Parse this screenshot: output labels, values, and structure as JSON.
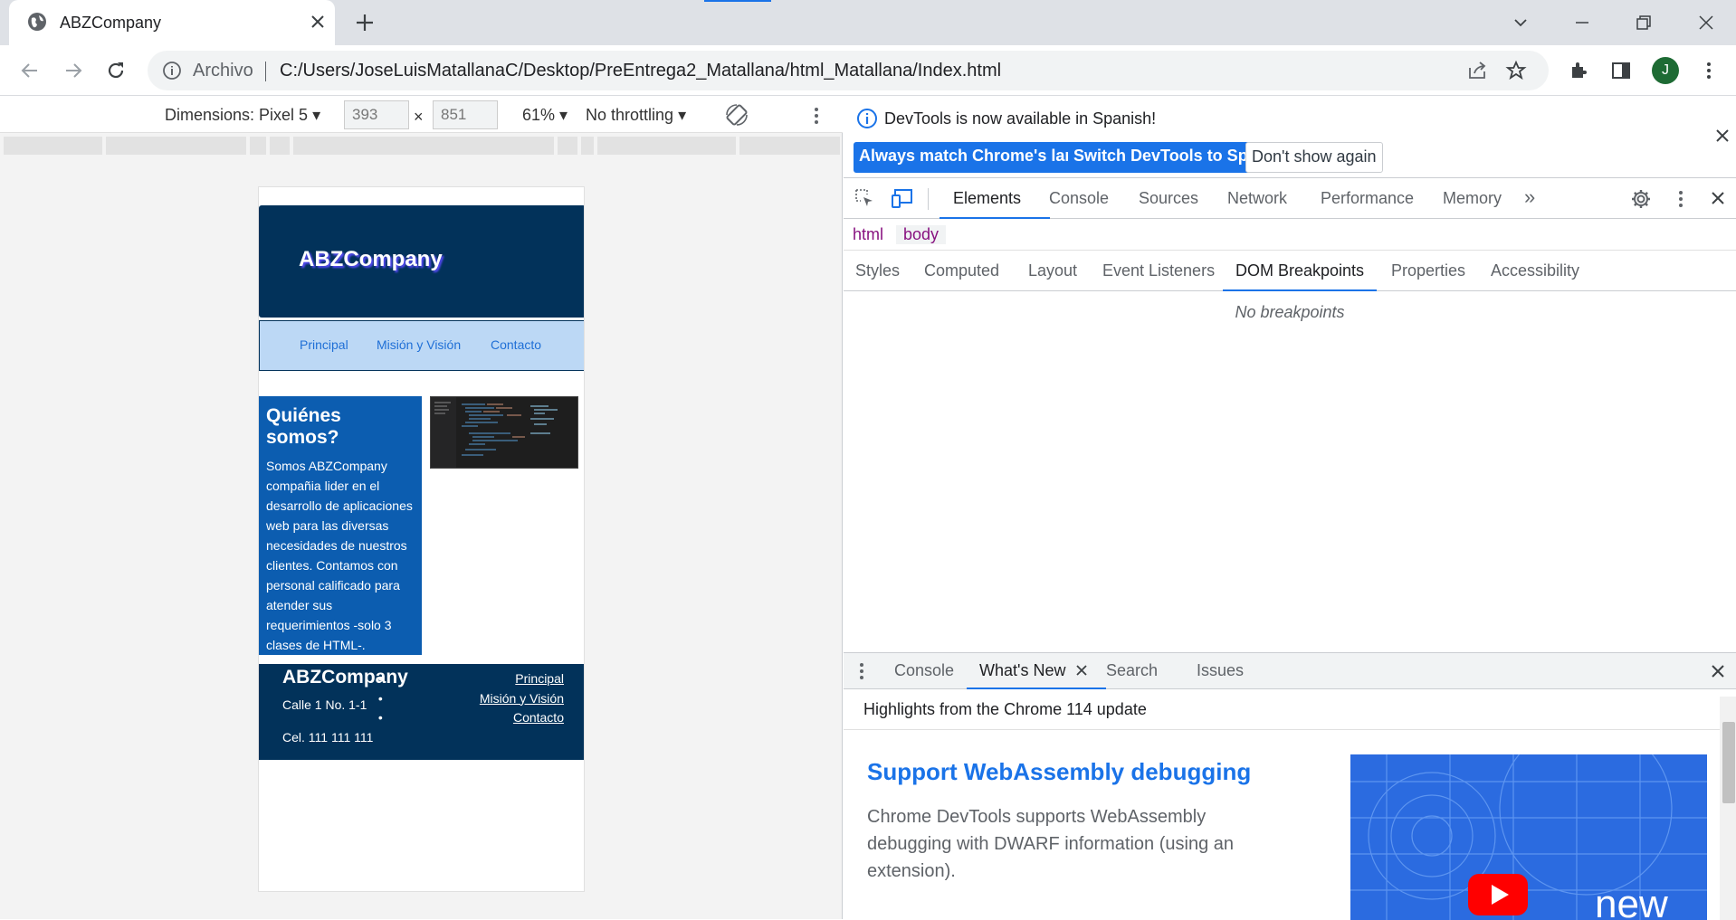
{
  "browser": {
    "tab_title": "ABZCompany",
    "scheme_label": "Archivo",
    "url": "C:/Users/JoseLuisMatallanaC/Desktop/PreEntrega2_Matallana/html_Matallana/Index.html",
    "profile_initial": "J"
  },
  "device_toolbar": {
    "dimensions_label": "Dimensions: Pixel 5",
    "width": "393",
    "height": "851",
    "times": "×",
    "zoom": "61%",
    "throttling": "No throttling"
  },
  "site": {
    "brand": "ABZCompany",
    "nav": [
      "Principal",
      "Misión y Visión",
      "Contacto"
    ],
    "about_title": "Quiénes somos?",
    "about_text": "Somos ABZCompany compañia lider en el desarrollo de aplicaciones web para las diversas necesidades de nuestros clientes. Contamos con personal calificado para atender sus requerimientos -solo 3 clases de HTML-.",
    "footer_brand": "ABZCompany",
    "footer_address": "Calle 1 No. 1-1",
    "footer_phone": "Cel. 111 111 111",
    "footer_links": [
      "Principal",
      "Misión y Visión",
      "Contacto"
    ]
  },
  "devtools": {
    "info_message": "DevTools is now available in Spanish!",
    "btn_match": "Always match Chrome's language",
    "btn_switch": "Switch DevTools to Spanish",
    "btn_dismiss": "Don't show again",
    "main_tabs": [
      "Elements",
      "Console",
      "Sources",
      "Network",
      "Performance",
      "Memory"
    ],
    "active_main_tab": "Elements",
    "breadcrumbs": [
      "html",
      "body"
    ],
    "sub_tabs": [
      "Styles",
      "Computed",
      "Layout",
      "Event Listeners",
      "DOM Breakpoints",
      "Properties",
      "Accessibility"
    ],
    "active_sub_tab": "DOM Breakpoints",
    "empty_message": "No breakpoints",
    "drawer_tabs": [
      "Console",
      "What's New",
      "Search",
      "Issues"
    ],
    "active_drawer_tab": "What's New",
    "highlights": "Highlights from the Chrome 114 update",
    "whatsnew_title": "Support WebAssembly debugging",
    "whatsnew_desc": "Chrome DevTools supports WebAssembly debugging with DWARF information (using an extension).",
    "whatsnew_badge": "new"
  },
  "colors": {
    "accent": "#1a73e8",
    "site_header": "#02325a",
    "site_nav": "#bcd8f5",
    "site_about": "#0c5db0"
  }
}
